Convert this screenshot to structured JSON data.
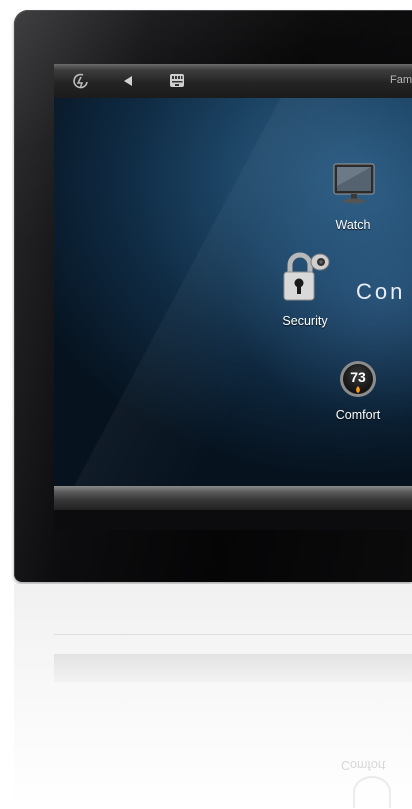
{
  "topbar": {
    "home_icon": "power-swirl-icon",
    "back_icon": "back-arrow-icon",
    "keypad_icon": "keypad-icon",
    "title": "Fam"
  },
  "tiles": {
    "watch": {
      "label": "Watch",
      "icon": "tv-icon"
    },
    "security": {
      "label": "Security",
      "icon": "padlock-camera-icon"
    },
    "comfort": {
      "label": "Comfort",
      "icon": "thermostat-icon",
      "temperature": "73"
    }
  },
  "brand": {
    "text": "Con"
  },
  "reflection": {
    "label": "Comfort"
  },
  "colors": {
    "screen_blue": "#1d4566",
    "bezel": "#0d0d0f",
    "flame": "#ff9a1a"
  }
}
